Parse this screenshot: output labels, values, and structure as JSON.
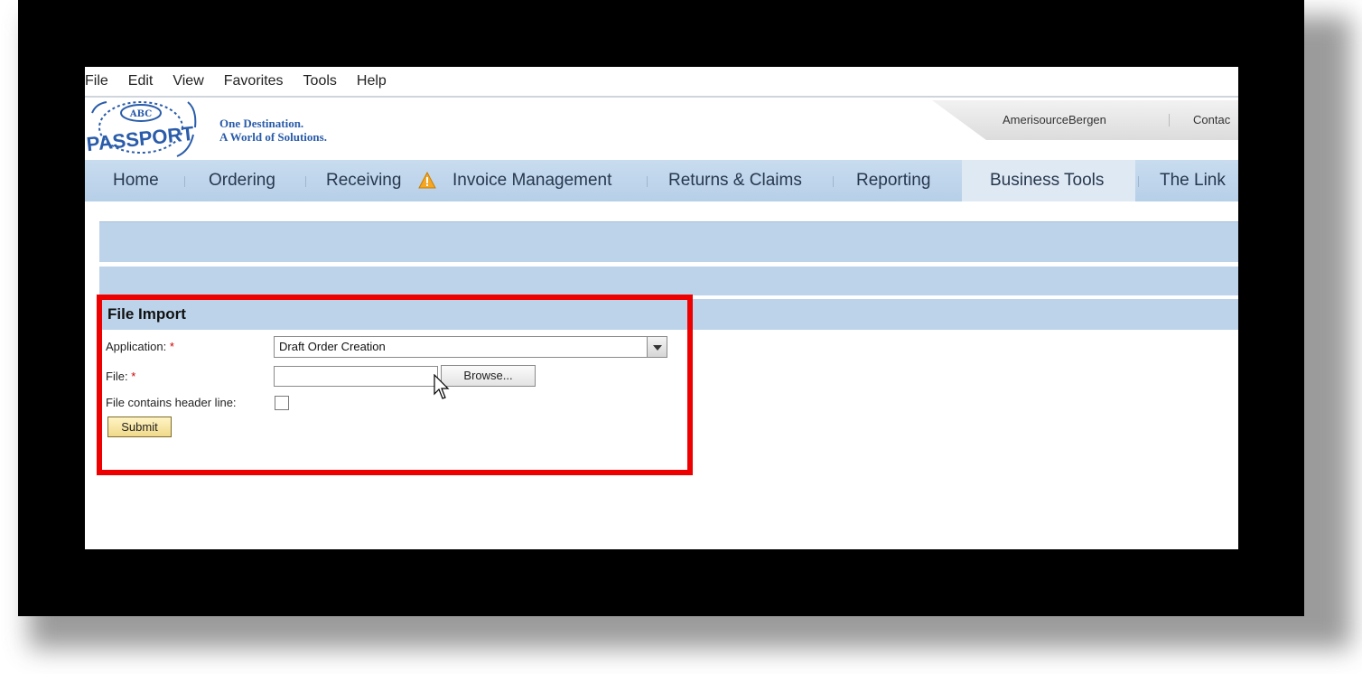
{
  "menu": [
    "File",
    "Edit",
    "View",
    "Favorites",
    "Tools",
    "Help"
  ],
  "header": {
    "logo_text": "PASSPORT",
    "logo_badge": "ABC",
    "tagline_line1": "One Destination.",
    "tagline_line2": "A World of Solutions.",
    "util_links": [
      "AmerisourceBergen",
      "Contac"
    ]
  },
  "nav": {
    "items": [
      "Home",
      "Ordering",
      "Receiving",
      "Invoice Management",
      "Returns & Claims",
      "Reporting",
      "Business Tools",
      "The Link"
    ],
    "active": "Business Tools"
  },
  "form": {
    "title": "File Import",
    "application_label": "Application:",
    "application_value": "Draft Order Creation",
    "file_label": "File:",
    "required_mark": "*",
    "browse_label": "Browse...",
    "header_line_label": "File contains header line:",
    "submit_label": "Submit"
  },
  "colors": {
    "nav_bg": "#b6cfe8",
    "highlight": "#ee0000",
    "warning": "#f5a623"
  }
}
